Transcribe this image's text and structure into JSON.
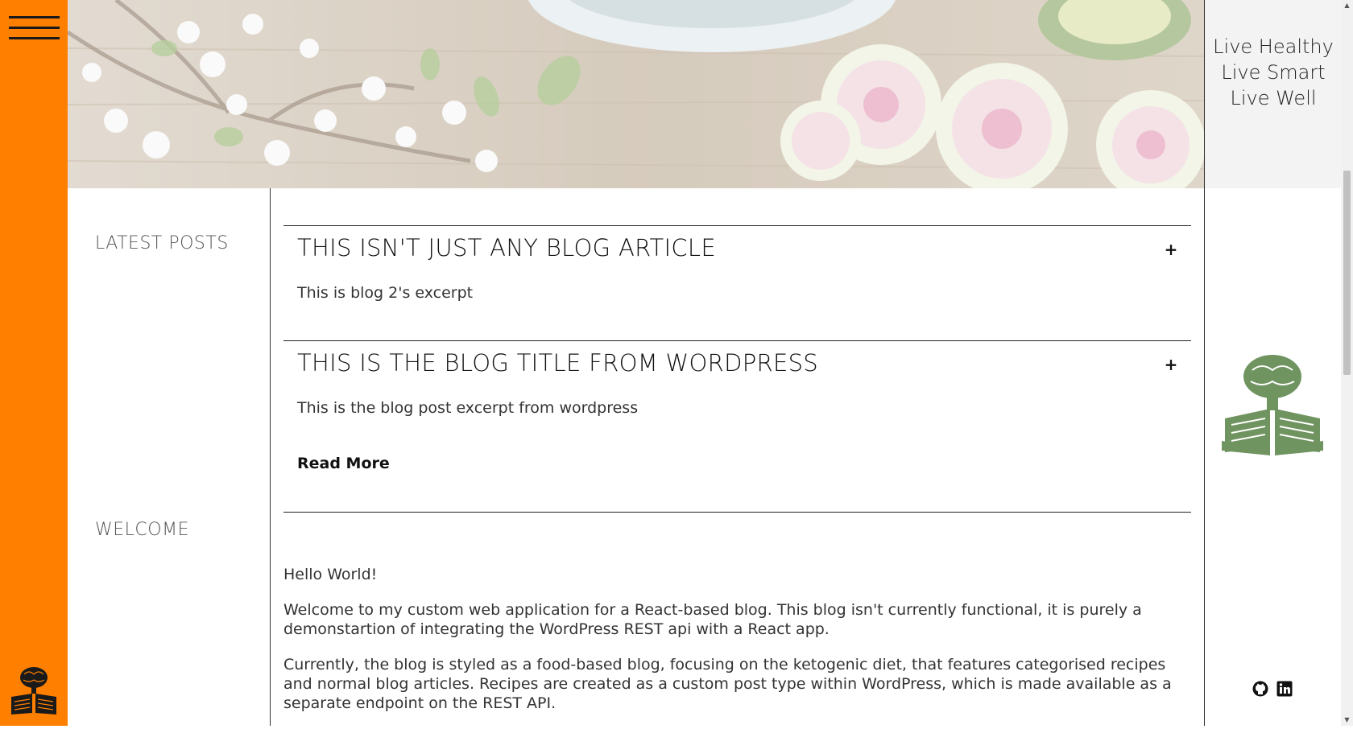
{
  "left_rail": {
    "menu_icon": "hamburger-menu-icon",
    "logo_icon": "brain-book-logo-icon",
    "background": "#ff7f00"
  },
  "hero": {
    "image": "food-flowers-banner"
  },
  "right_col": {
    "tagline": [
      "Live Healthy",
      "Live Smart",
      "Live Well"
    ],
    "logo_icon": "brain-book-logo-icon",
    "logo_color": "#6f9460",
    "social": [
      {
        "icon": "github-icon"
      },
      {
        "icon": "linkedin-icon"
      }
    ]
  },
  "side": {
    "latest_posts": "LATEST POSTS",
    "welcome": "WELCOME"
  },
  "posts": [
    {
      "title": "THIS ISN'T JUST ANY BLOG ARTICLE",
      "excerpt": "This is blog 2's excerpt",
      "toggle": "+"
    },
    {
      "title": "THIS IS THE BLOG TITLE FROM WORDPRESS",
      "excerpt": "This is the blog post excerpt from wordpress",
      "toggle": "+",
      "read_more": "Read More"
    }
  ],
  "welcome": {
    "p1": "Hello World!",
    "p2": "Welcome to my custom web application for a React-based blog. This blog isn't currently functional, it is purely a demonstartion of integrating the WordPress REST api with a React app.",
    "p3": "Currently, the blog is styled as a food-based blog, focusing on the ketogenic diet, that features categorised recipes and normal blog articles. Recipes are created as a custom post type within WordPress, which is made available as a separate endpoint on the REST API."
  }
}
